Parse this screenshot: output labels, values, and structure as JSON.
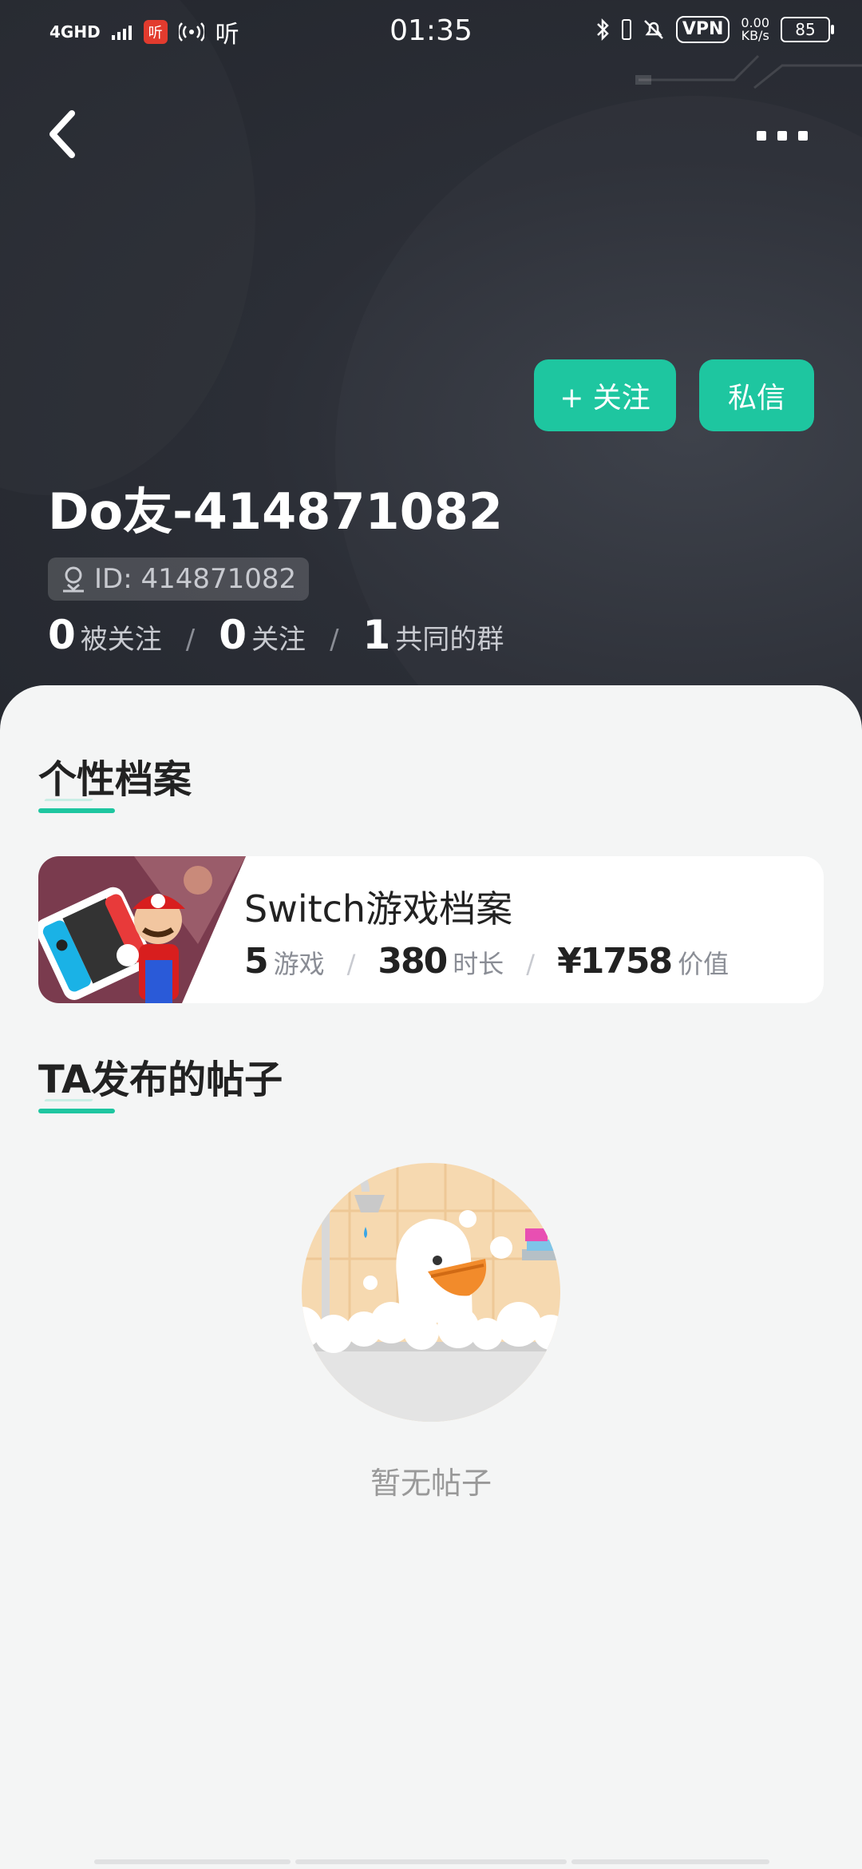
{
  "status_bar": {
    "network": "4GHD",
    "app_icon_text": "听",
    "extra_icon_text": "听",
    "time": "01:35",
    "vpn": "VPN",
    "speed_value": "0.00",
    "speed_unit": "KB/s",
    "battery": "85"
  },
  "actions": {
    "follow": "+ 关注",
    "message": "私信"
  },
  "profile": {
    "name": "Do友-414871082",
    "id_label": "ID: 414871082",
    "followers_count": "0",
    "followers_label": "被关注",
    "following_count": "0",
    "following_label": "关注",
    "groups_count": "1",
    "groups_label": "共同的群",
    "separator": "/"
  },
  "sections": {
    "profile_title": "个性档案",
    "posts_title": "TA发布的帖子"
  },
  "switch_card": {
    "title": "Switch游戏档案",
    "games_count": "5",
    "games_label": "游戏",
    "hours_count": "380",
    "hours_label": "时长",
    "value_amount": "¥1758",
    "value_label": "价值",
    "separator": "/"
  },
  "empty_state": {
    "text": "暂无帖子"
  },
  "colors": {
    "accent": "#1ec6a0",
    "header_bg": "#2b2e36",
    "sheet_bg": "#f4f5f5"
  }
}
